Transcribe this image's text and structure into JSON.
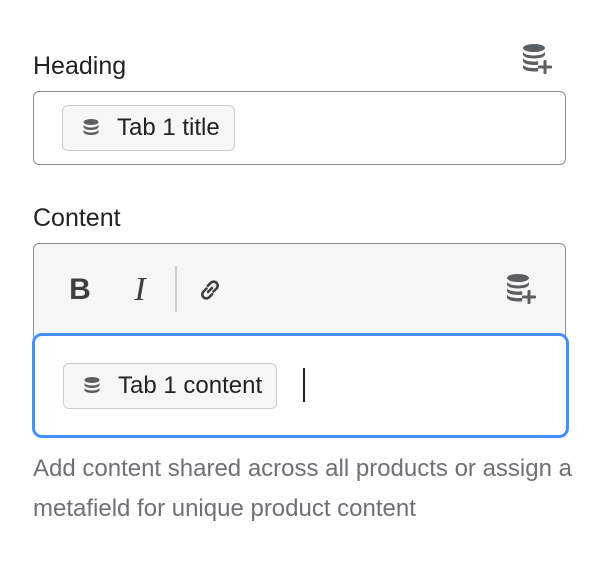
{
  "heading": {
    "label": "Heading",
    "connect_icon": "database-plus-icon",
    "pill": {
      "icon": "database-icon",
      "text": "Tab 1 title"
    }
  },
  "content": {
    "label": "Content",
    "toolbar": {
      "bold_label": "B",
      "italic_label": "I",
      "link_icon": "link-icon",
      "connect_icon": "database-plus-icon"
    },
    "pill": {
      "icon": "database-icon",
      "text": "Tab 1 content"
    },
    "help_text": "Add content shared across all products or assign a metafield for unique product content"
  },
  "colors": {
    "focus_border": "#458fff",
    "border": "#8c9196",
    "help_text": "#6d7175"
  }
}
